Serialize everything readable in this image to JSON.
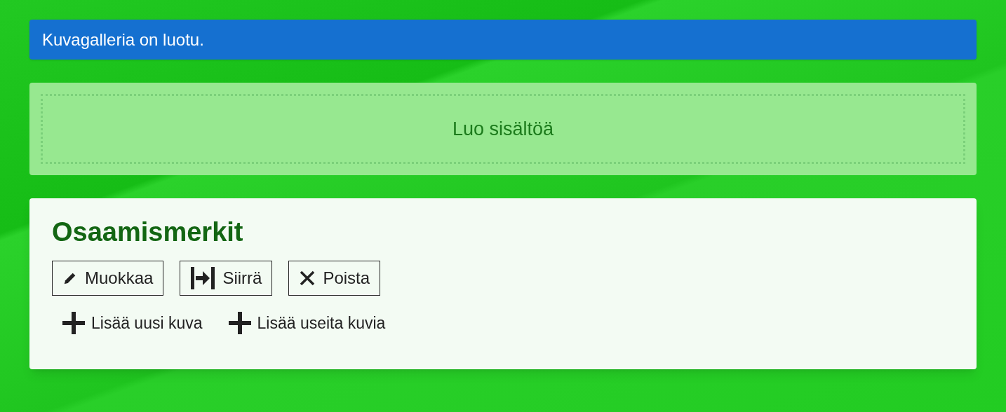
{
  "notice": {
    "text": "Kuvagalleria on luotu."
  },
  "create_content": {
    "label": "Luo sisältöä"
  },
  "gallery": {
    "title": "Osaamismerkit",
    "actions": [
      {
        "kind": "edit",
        "label": "Muokkaa"
      },
      {
        "kind": "move",
        "label": "Siirrä"
      },
      {
        "kind": "delete",
        "label": "Poista"
      }
    ],
    "add_links": [
      {
        "label": "Lisää uusi kuva"
      },
      {
        "label": "Lisää useita kuvia"
      }
    ]
  }
}
